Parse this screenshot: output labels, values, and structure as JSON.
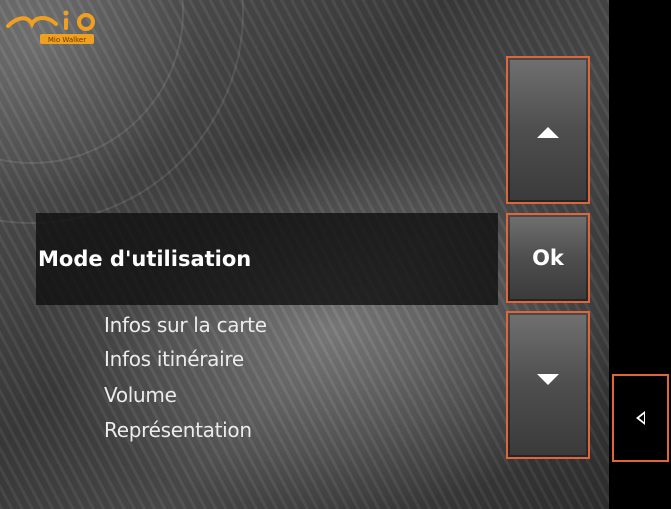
{
  "logo": {
    "brand": "Mio",
    "badge": "Mio Walker"
  },
  "menu": {
    "selected": "Mode d'utilisation",
    "items": [
      "Infos sur la carte",
      "Infos itinéraire",
      "Volume",
      "Représentation"
    ]
  },
  "buttons": {
    "up_icon": "arrow-up-icon",
    "ok_label": "Ok",
    "down_icon": "arrow-down-icon",
    "back_icon": "back-arrow-icon"
  },
  "colors": {
    "accent": "#e0663a",
    "logo": "#f0a020"
  }
}
